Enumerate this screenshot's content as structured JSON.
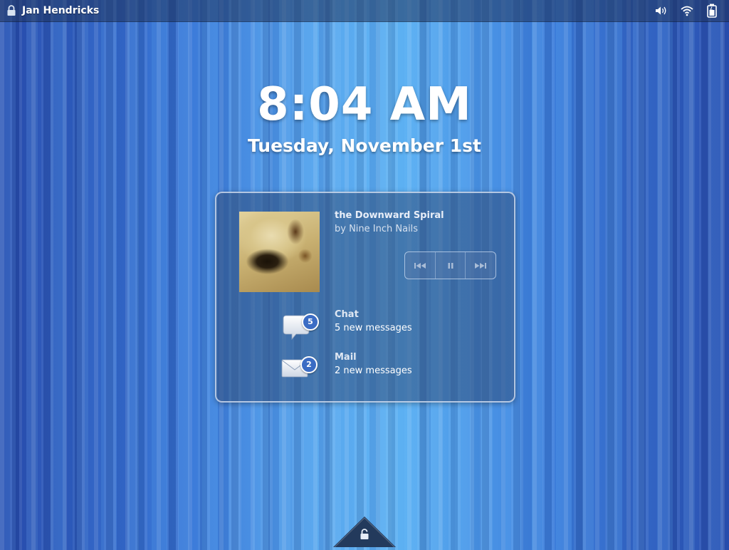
{
  "status_bar": {
    "user_name": "Jan Hendricks",
    "icons": [
      "lock-icon",
      "volume-icon",
      "wifi-icon",
      "battery-icon"
    ]
  },
  "lock_screen": {
    "time": "8:04 AM",
    "date": "Tuesday, November 1st"
  },
  "now_playing": {
    "title": "the Downward Spiral",
    "artist": "by Nine Inch Nails",
    "controls": [
      "previous-icon",
      "pause-icon",
      "next-icon"
    ]
  },
  "notifications": [
    {
      "app": "Chat",
      "count": "5",
      "message": "5 new messages",
      "icon": "chat-bubble-icon"
    },
    {
      "app": "Mail",
      "count": "2",
      "message": "2 new messages",
      "icon": "envelope-icon"
    }
  ],
  "colors": {
    "background": "#3a78d8",
    "badge": "#3b6cc4"
  }
}
